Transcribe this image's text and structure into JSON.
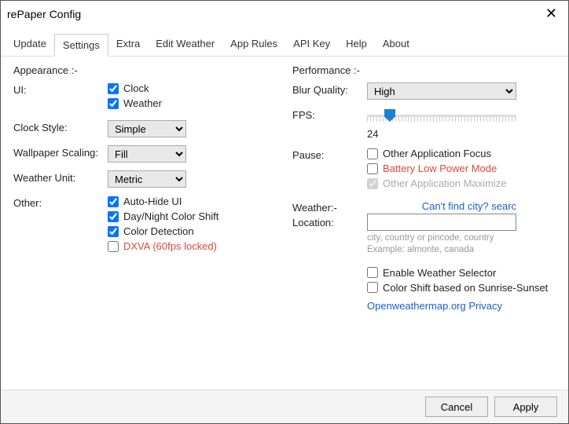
{
  "title": "rePaper Config",
  "tabs": [
    "Update",
    "Settings",
    "Extra",
    "Edit Weather",
    "App Rules",
    "API Key",
    "Help",
    "About"
  ],
  "active_tab": 1,
  "left": {
    "appearance": "Appearance :-",
    "ui_label": "UI:",
    "ui_clock": "Clock",
    "ui_weather": "Weather",
    "clock_style_label": "Clock Style:",
    "clock_style_value": "Simple",
    "wallpaper_scaling_label": "Wallpaper Scaling:",
    "wallpaper_scaling_value": "Fill",
    "weather_unit_label": "Weather Unit:",
    "weather_unit_value": "Metric",
    "other_label": "Other:",
    "auto_hide": "Auto-Hide UI",
    "daynight": "Day/Night Color Shift",
    "color_detect": "Color Detection",
    "dxva": "DXVA (60fps locked)"
  },
  "right": {
    "performance": "Performance :-",
    "blur_label": "Blur Quality:",
    "blur_value": "High",
    "fps_label": "FPS:",
    "fps_value": "24",
    "pause_label": "Pause:",
    "pause_focus": "Other Application Focus",
    "pause_battery": "Battery Low Power Mode",
    "pause_maximize": "Other Application Maximize",
    "weather_head": "Weather:-",
    "location_label": "Location:",
    "location_value": "",
    "find_city": "Can't find city? searc",
    "hint": "city, country or pincode, country\nExample: almonte, canada",
    "enable_selector": "Enable Weather Selector",
    "sunrise_shift": "Color Shift based on Sunrise-Sunset",
    "privacy": "Openweathermap.org Privacy"
  },
  "footer": {
    "cancel": "Cancel",
    "apply": "Apply"
  }
}
